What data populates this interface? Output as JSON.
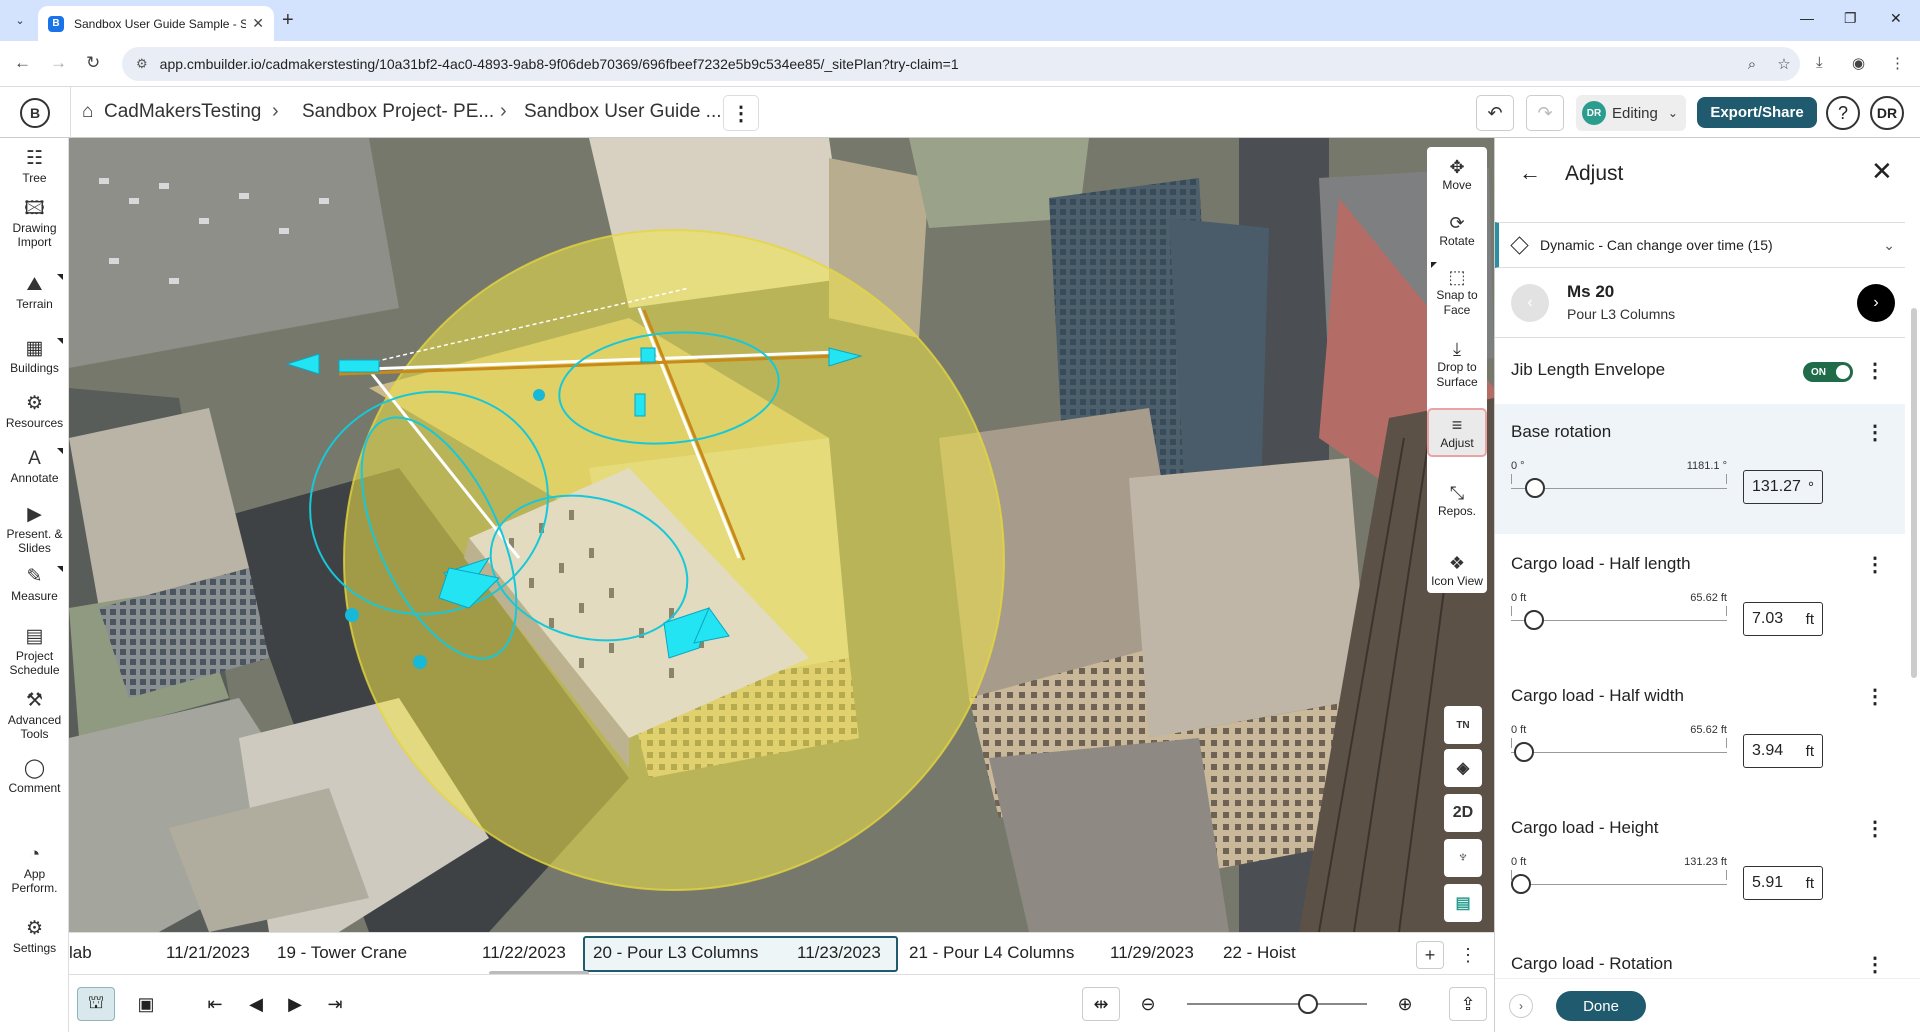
{
  "browser": {
    "tab_title": "Sandbox User Guide Sample - S",
    "favicon_letter": "B",
    "url": "app.cmbuilder.io/cadmakerstesting/10a31bf2-4ac0-4893-9ab8-9f06deb70369/696fbeef7232e5b9c534ee85/_sitePlan?try-claim=1"
  },
  "header": {
    "logo_letter": "B",
    "breadcrumbs": [
      "CadMakersTesting",
      "Sandbox Project- PE...",
      "Sandbox User Guide ..."
    ],
    "user_initials": "DR",
    "mode_label": "Editing",
    "export_label": "Export/Share",
    "help_label": "?",
    "avatar_initials": "DR"
  },
  "left_toolbar": [
    {
      "label": "Tree",
      "icon": "tree-icon",
      "glyph": "☷"
    },
    {
      "label": "Drawing\nImport",
      "icon": "drawing-import-icon",
      "glyph": "🖾"
    },
    {
      "label": "Terrain",
      "icon": "terrain-icon",
      "glyph": "⛰"
    },
    {
      "label": "Buildings",
      "icon": "buildings-icon",
      "glyph": "▦"
    },
    {
      "label": "Resources",
      "icon": "resources-icon",
      "glyph": "⚙"
    },
    {
      "label": "Annotate",
      "icon": "annotate-icon",
      "glyph": "A"
    },
    {
      "label": "Present. &\nSlides",
      "icon": "present-icon",
      "glyph": "▶"
    },
    {
      "label": "Measure",
      "icon": "measure-icon",
      "glyph": "✎"
    },
    {
      "label": "Project\nSchedule",
      "icon": "schedule-icon",
      "glyph": "▤"
    },
    {
      "label": "Advanced\nTools",
      "icon": "advanced-tools-icon",
      "glyph": "⚒"
    },
    {
      "label": "Comment",
      "icon": "comment-icon",
      "glyph": "◯"
    },
    {
      "label": "App\nPerform.",
      "icon": "performance-icon",
      "glyph": "◔"
    },
    {
      "label": "Settings",
      "icon": "settings-icon",
      "glyph": "⚙"
    }
  ],
  "map_tools": [
    {
      "label": "Move",
      "icon": "move-icon",
      "glyph": "✥"
    },
    {
      "label": "Rotate",
      "icon": "rotate-icon",
      "glyph": "⟳"
    },
    {
      "label": "Snap to\nFace",
      "icon": "snap-face-icon",
      "glyph": "⬚"
    },
    {
      "label": "Drop to\nSurface",
      "icon": "drop-surface-icon",
      "glyph": "⤓"
    },
    {
      "label": "Adjust",
      "icon": "adjust-icon",
      "glyph": "≡"
    },
    {
      "label": "Repos.",
      "icon": "reposition-icon",
      "glyph": "⤡"
    },
    {
      "label": "Icon View",
      "icon": "icon-view-icon",
      "glyph": "❖"
    }
  ],
  "map_small_tools": [
    {
      "name": "true-north-icon",
      "glyph": "TN"
    },
    {
      "name": "view-cube-icon",
      "glyph": "◈"
    },
    {
      "name": "2d-toggle-button",
      "glyph": "2D"
    },
    {
      "name": "street-view-icon",
      "glyph": "♆"
    },
    {
      "name": "layers-icon",
      "glyph": "▤"
    }
  ],
  "timeline": {
    "items": [
      "lab",
      "11/21/2023",
      "19 - Tower Crane",
      "11/22/2023",
      "20 - Pour L3 Columns",
      "11/23/2023",
      "21 - Pour L4 Columns",
      "11/29/2023",
      "22 - Hoist"
    ],
    "add_label": "+",
    "more_label": "⋮"
  },
  "bottom_controls": {
    "zoom_level": 0.67
  },
  "panel": {
    "title": "Adjust",
    "dynamic_label": "Dynamic - Can change over time (15)",
    "milestone_name": "Ms 20",
    "milestone_sub": "Pour L3 Columns",
    "envelope_label": "Jib Length Envelope",
    "envelope_toggle": "ON",
    "params": [
      {
        "label": "Base rotation",
        "min": "0 °",
        "max": "1181.1 °",
        "value": "131.27",
        "unit": "°",
        "fraction": 0.111
      },
      {
        "label": "Cargo load - Half length",
        "min": "0 ft",
        "max": "65.62 ft",
        "value": "7.03",
        "unit": "ft",
        "fraction": 0.107
      },
      {
        "label": "Cargo load - Half width",
        "min": "0 ft",
        "max": "65.62 ft",
        "value": "3.94",
        "unit": "ft",
        "fraction": 0.06
      },
      {
        "label": "Cargo load - Height",
        "min": "0 ft",
        "max": "131.23 ft",
        "value": "5.91",
        "unit": "ft",
        "fraction": 0.045
      }
    ],
    "partial_label": "Cargo load - Rotation",
    "done_label": "Done"
  },
  "colors": {
    "accent": "#1f5a6e",
    "toggle_on": "#1f6b4a",
    "crane_handles": "#22e4f2",
    "envelope": "#f2e64a"
  }
}
